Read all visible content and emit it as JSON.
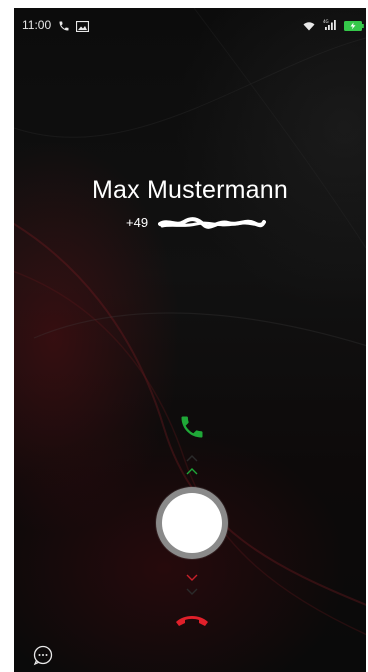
{
  "status_bar": {
    "time": "11:00",
    "left_icons": [
      "phone-call-icon",
      "image-notification-icon"
    ],
    "right_icons": [
      "wifi-icon",
      "signal-icon",
      "battery-charging-icon"
    ]
  },
  "caller": {
    "name": "Max Mustermann",
    "number_prefix": "+49"
  },
  "controls": {
    "accept_icon": "phone-accept-icon",
    "decline_icon": "phone-decline-icon",
    "slider": "answer-slider-knob",
    "message_icon": "message-icon"
  },
  "colors": {
    "accept": "#1fa838",
    "decline": "#e0202a",
    "background": "#0d0d0d"
  }
}
